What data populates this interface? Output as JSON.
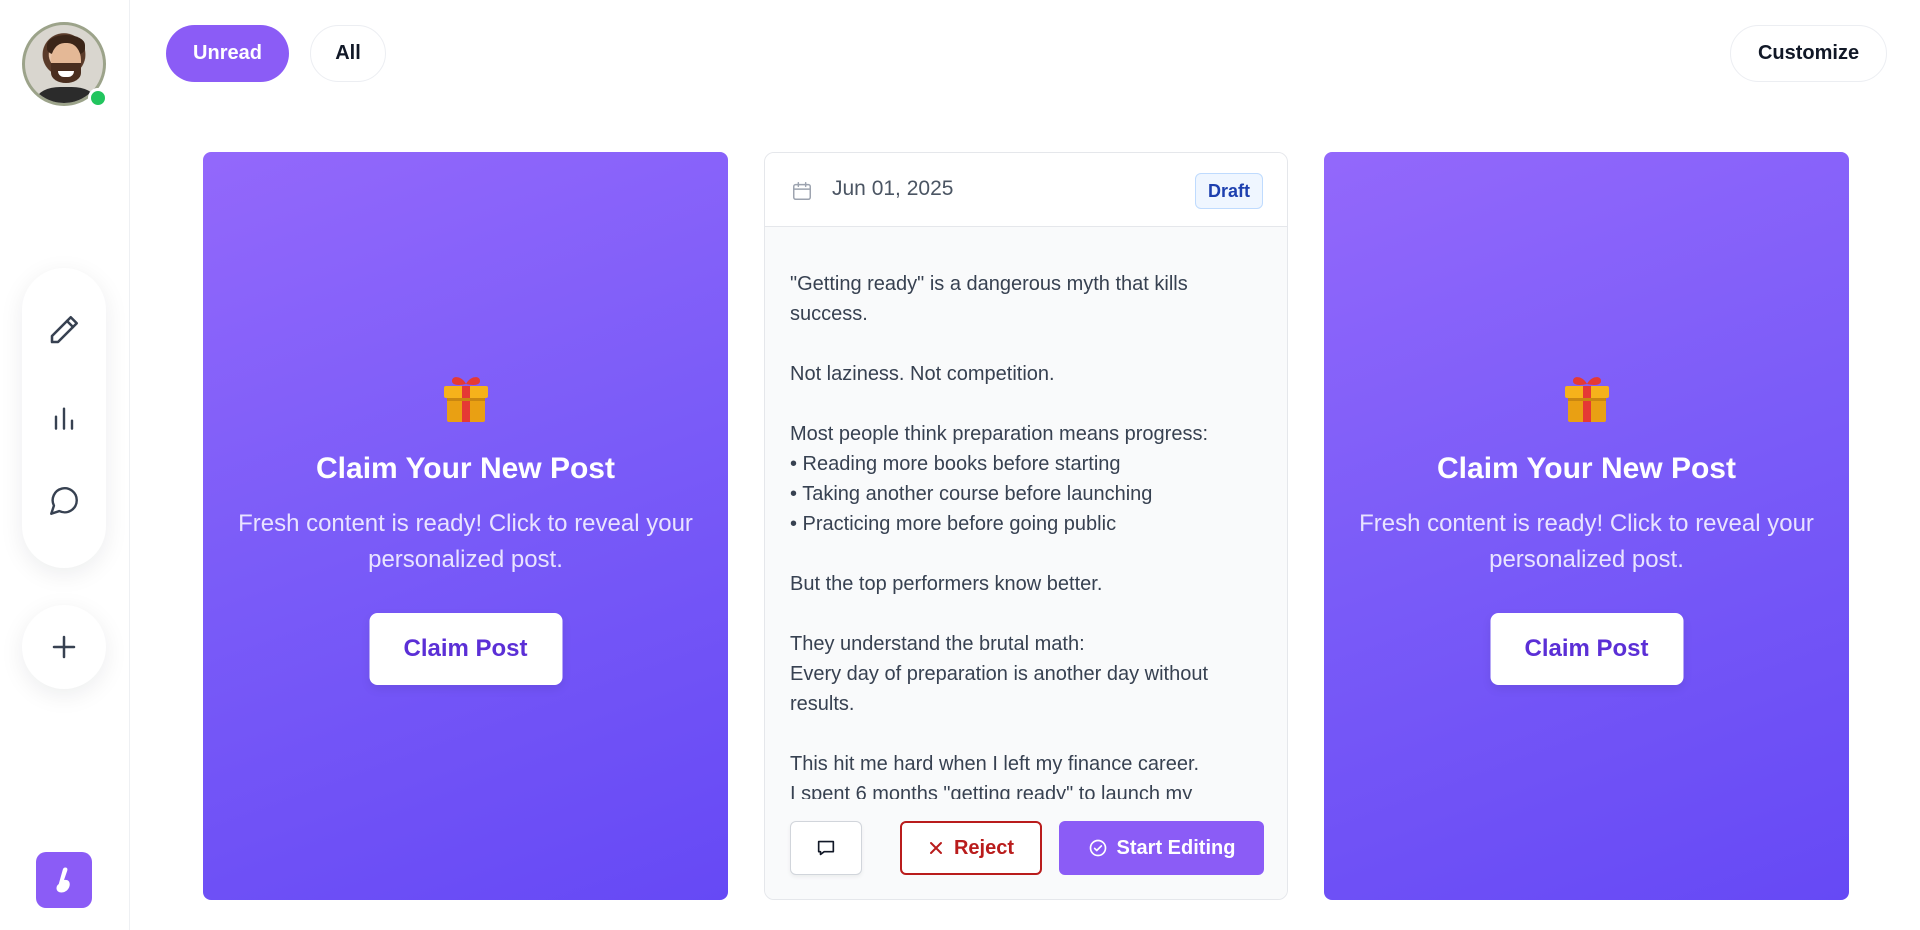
{
  "filters": {
    "unread_label": "Unread",
    "all_label": "All"
  },
  "header": {
    "customize_label": "Customize"
  },
  "sidebar": {
    "tools": [
      {
        "icon": "pencil-icon"
      },
      {
        "icon": "bar-chart-icon"
      },
      {
        "icon": "chat-bubble-icon"
      }
    ],
    "add_icon": "plus-icon",
    "logo_icon": "brand-logo-icon",
    "online_status_color": "#22c55e"
  },
  "cards": {
    "left": {
      "icon": "gift-icon",
      "title": "Claim Your New Post",
      "subtitle": "Fresh content is ready! Click to reveal your personalized post.",
      "button_label": "Claim Post"
    },
    "center": {
      "date": "Jun 01, 2025",
      "status": "Draft",
      "body_lines": [
        "\"Getting ready\" is a dangerous myth that kills success.",
        "",
        "Not laziness. Not competition.",
        "",
        "Most people think preparation means progress:",
        "• Reading more books before starting",
        "• Taking another course before launching",
        "• Practicing more before going public",
        "",
        "But the top performers know better.",
        "",
        "They understand the brutal math:",
        "Every day of preparation is another day without results.",
        "",
        "This hit me hard when I left my finance career.",
        "I spent 6 months \"getting ready\" to launch my"
      ],
      "reject_label": "Reject",
      "edit_label": "Start Editing"
    },
    "right": {
      "icon": "gift-icon",
      "title": "Claim Your New Post",
      "subtitle": "Fresh content is ready! Click to reveal your personalized post.",
      "button_label": "Claim Post"
    }
  },
  "colors": {
    "accent": "#8b5cf6",
    "reject": "#b91c1c",
    "draft_badge_text": "#1e40af"
  }
}
